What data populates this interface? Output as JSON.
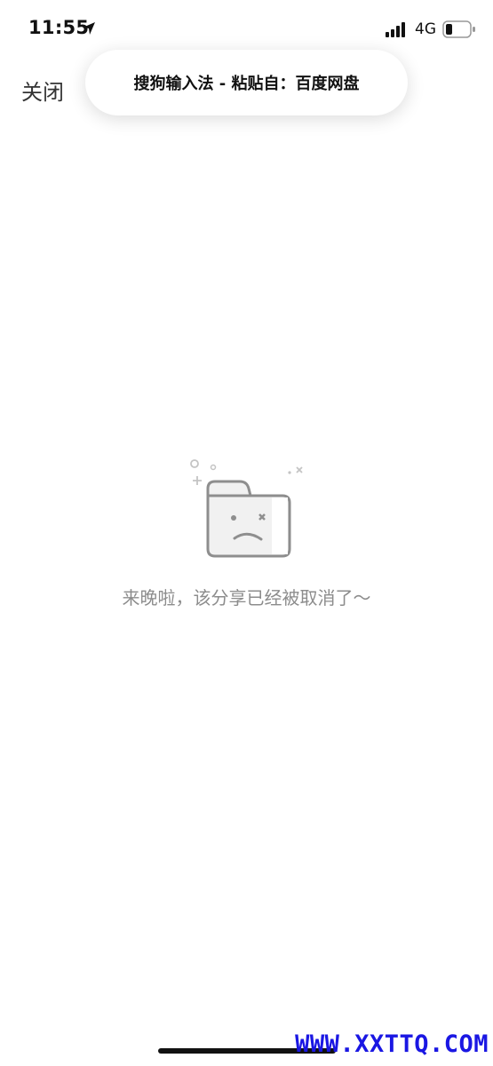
{
  "status_bar": {
    "time": "11:55",
    "network": "4G",
    "location_icon": "location-arrow-icon",
    "signal_icon": "cellular-signal-icon",
    "battery_icon": "battery-low-icon"
  },
  "header": {
    "close_label": "关闭"
  },
  "toast": {
    "text": "搜狗输入法 - 粘贴自：百度网盘"
  },
  "empty_state": {
    "icon": "sad-folder-icon",
    "message": "来晚啦，该分享已经被取消了～"
  },
  "watermark": {
    "text": "WWW.XXTTQ.COM",
    "color": "#1a17e3"
  }
}
